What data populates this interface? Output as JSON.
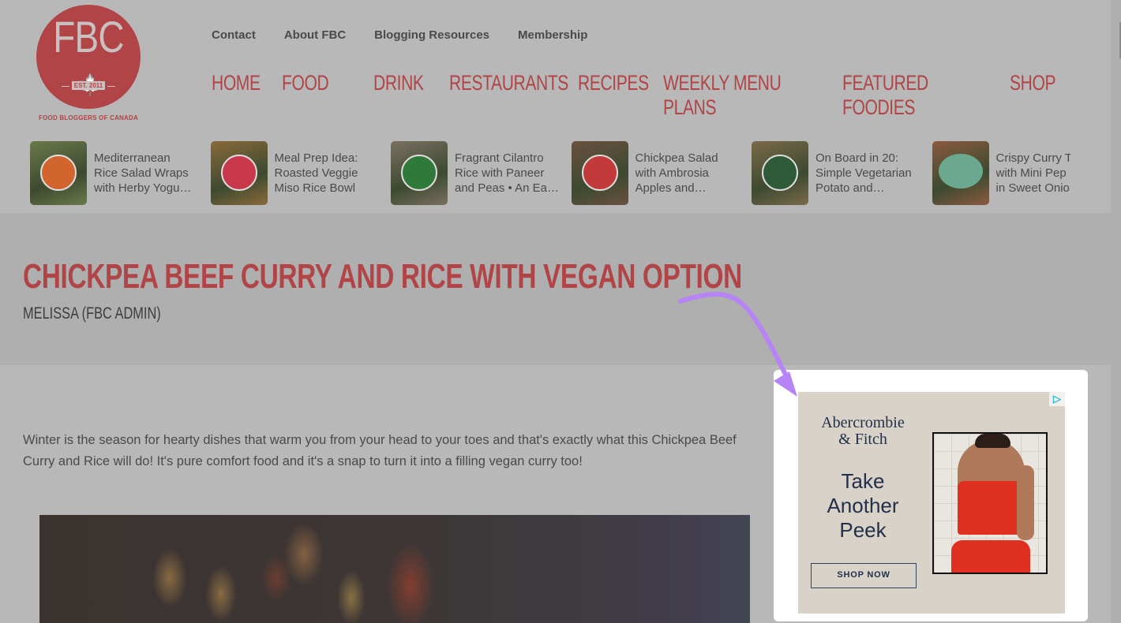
{
  "logo": {
    "text": "FBC",
    "est": "EST. 2011",
    "caption": "FOOD BLOGGERS OF CANADA",
    "leaf_glyph": "🍁"
  },
  "top_nav": [
    "Contact",
    "About FBC",
    "Blogging Resources",
    "Membership"
  ],
  "main_nav": [
    "HOME",
    "FOOD",
    "DRINK",
    "RESTAURANTS",
    "RECIPES",
    "WEEKLY MENU PLANS",
    "FEATURED FOODIES",
    "SHOP"
  ],
  "carousel": [
    {
      "title_lines": [
        "Mediterranean",
        "Rice Salad Wraps",
        "with Herby Yogu…"
      ],
      "badge_color": "#d2652e",
      "thumb_color": "#6a7a4a"
    },
    {
      "title_lines": [
        "Meal Prep Idea:",
        "Roasted Veggie",
        "Miso Rice Bowl"
      ],
      "badge_color": "#c8374a",
      "thumb_color": "#8a6a3a"
    },
    {
      "title_lines": [
        "Fragrant Cilantro",
        "Rice with Paneer",
        "and Peas • An Ea…"
      ],
      "badge_color": "#2f7a3a",
      "thumb_color": "#7a7060"
    },
    {
      "title_lines": [
        "Chickpea Salad",
        "with Ambrosia",
        "Apples and…"
      ],
      "badge_color": "#c23a3a",
      "thumb_color": "#6a5040"
    },
    {
      "title_lines": [
        "On Board in 20:",
        "Simple Vegetarian",
        "Potato and…"
      ],
      "badge_color": "#2e5a38",
      "thumb_color": "#7a6a4a"
    },
    {
      "title_lines": [
        "Crispy Curry T",
        "with Mini Pep",
        "in Sweet Onio"
      ],
      "badge_color": "#6aa890",
      "thumb_color": "#8a5a40"
    }
  ],
  "post": {
    "title": "CHICKPEA BEEF CURRY AND RICE WITH VEGAN OPTION",
    "author": "MELISSA (FBC ADMIN)",
    "intro": "Winter is the season for hearty dishes that warm you from your head to your toes and that's exactly what this Chickpea Beef Curry and Rice will do! It's pure comfort food and it's a snap to turn it into a filling vegan curry too!"
  },
  "ad": {
    "brand_line1": "Abercrombie",
    "brand_line2": "& Fitch",
    "headline_lines": [
      "Take",
      "Another",
      "Peek"
    ],
    "cta": "SHOP NOW",
    "choices_glyph": "▷"
  },
  "colors": {
    "brand_red": "#b04446",
    "annotation_arrow": "#b784f5",
    "ad_navy": "#22304a"
  }
}
